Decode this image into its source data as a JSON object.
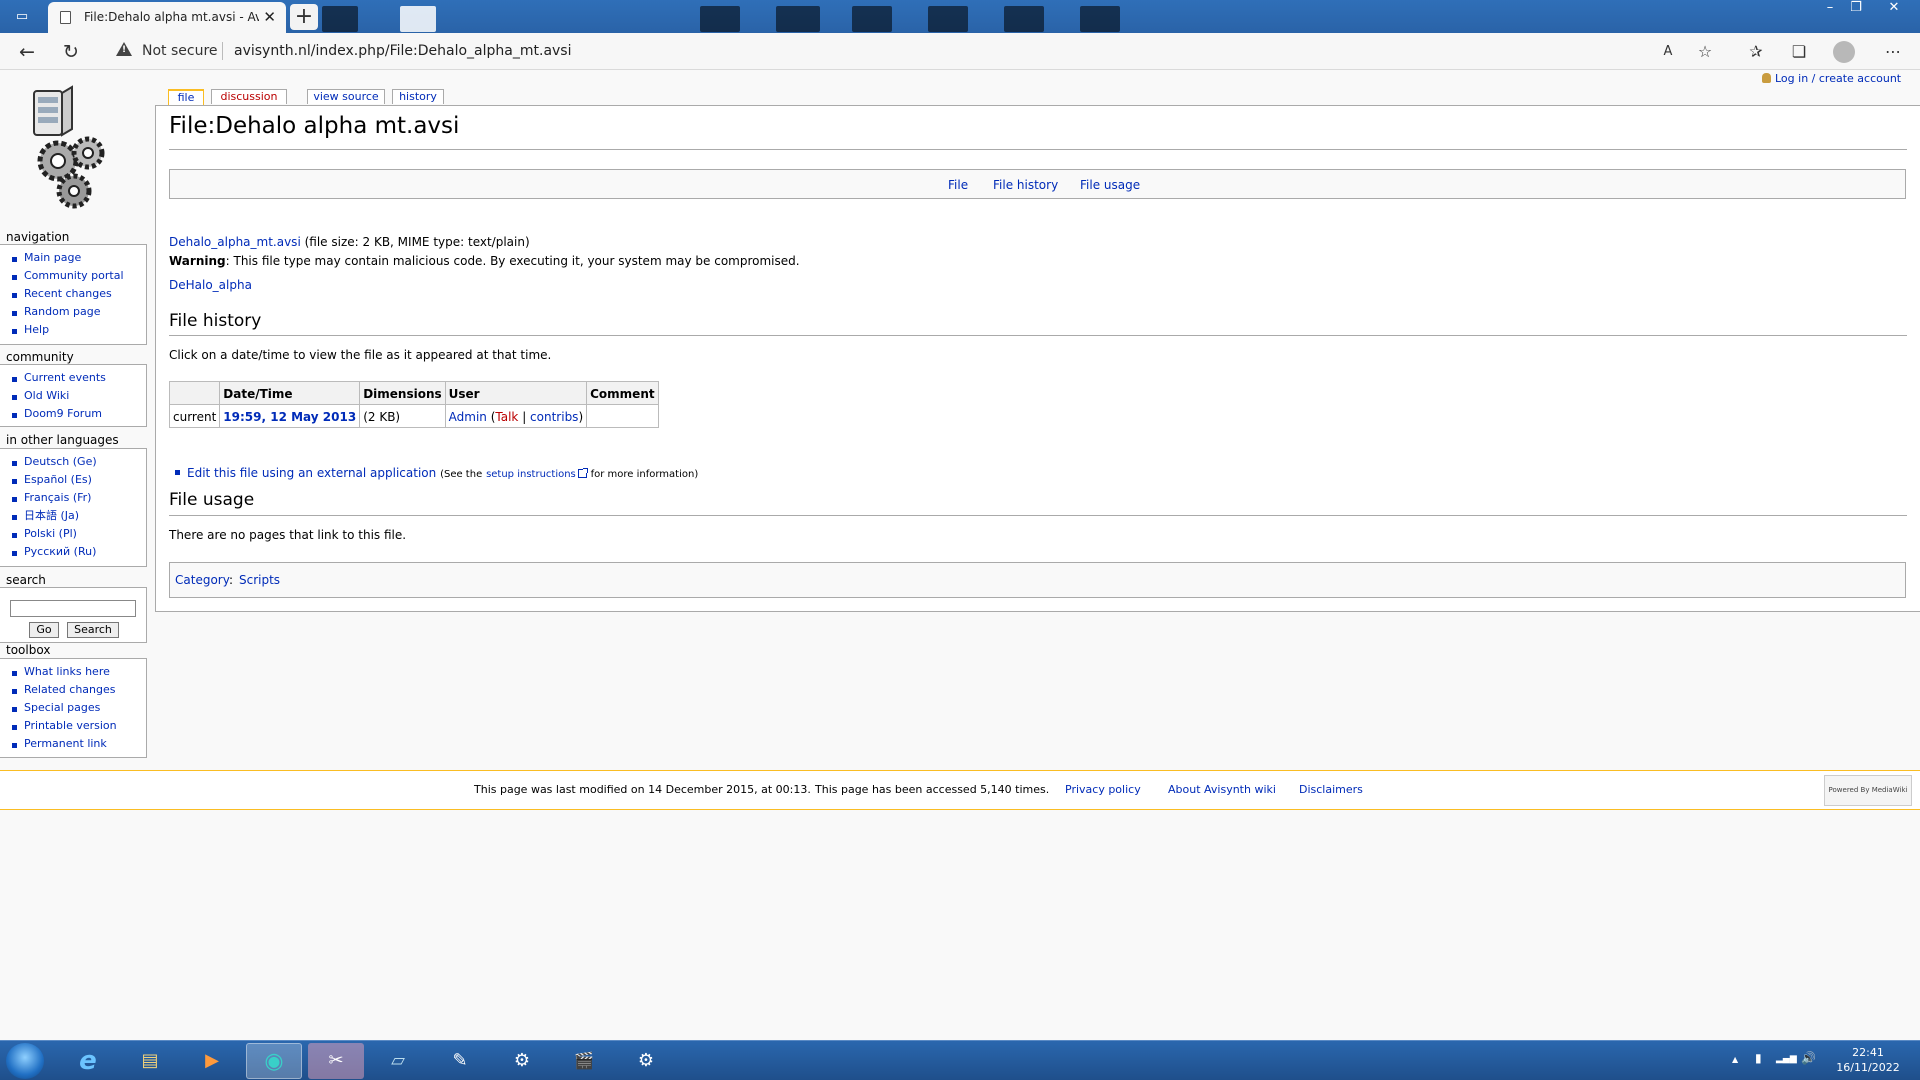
{
  "browser": {
    "tab_title": "File:Dehalo alpha mt.avsi - Avisynth",
    "tab_close": "✕",
    "new_tab": "+",
    "not_secure": "Not secure",
    "url": "avisynth.nl/index.php/File:Dehalo_alpha_mt.avsi",
    "icons": [
      "tab-actions-icon",
      "page-icon",
      "back-arrow-icon",
      "refresh-icon",
      "warning-icon",
      "read-aloud-icon",
      "add-favorite-icon",
      "favorites-icon",
      "collections-icon",
      "profile-icon",
      "more-icon"
    ],
    "window_controls": {
      "minimize": "–",
      "restore": "❐",
      "close": "✕"
    },
    "toolbar_glyphs": {
      "back": "←",
      "refresh": "↻",
      "read_aloud": "A",
      "add_favorite": "☆",
      "favorites": "✰",
      "collections": "❏",
      "more": "⋯"
    }
  },
  "personal": {
    "login": "Log in / create account"
  },
  "tabs": {
    "file": "file",
    "discussion": "discussion",
    "view_source": "view source",
    "history": "history"
  },
  "page": {
    "title": "File:Dehalo alpha mt.avsi",
    "filetoc": [
      "File",
      "File history",
      "File usage"
    ],
    "file_link": "Dehalo_alpha_mt.avsi",
    "file_info": "(file size: 2 KB, MIME type: text/plain)",
    "warning_label": "Warning",
    "warning_text": ": This file type may contain malicious code. By executing it, your system may be compromised.",
    "related_link": "DeHalo_alpha",
    "history_heading": "File history",
    "history_note": "Click on a date/time to view the file as it appeared at that time.",
    "history_table": {
      "headers": [
        "",
        "Date/Time",
        "Dimensions",
        "User",
        "Comment"
      ],
      "row": {
        "status": "current",
        "datetime": "19:59, 12 May 2013",
        "dimensions": "(2 KB)",
        "user": "Admin",
        "open_paren": " (",
        "talk": "Talk",
        "sep": " | ",
        "contribs": "contribs",
        "close_paren": ")",
        "comment": ""
      }
    },
    "edit_external": "Edit this file using an external application",
    "edit_note_pre": "(See the",
    "setup_link": "setup instructions",
    "edit_note_post": "for more information)",
    "usage_heading": "File usage",
    "usage_text": "There are no pages that link to this file.",
    "category_label": "Category",
    "category_colon": ":",
    "category": "Scripts"
  },
  "sidebar": {
    "navigation": {
      "heading": "navigation",
      "items": [
        "Main page",
        "Community portal",
        "Recent changes",
        "Random page",
        "Help"
      ]
    },
    "community": {
      "heading": "community",
      "items": [
        "Current events",
        "Old Wiki",
        "Doom9 Forum"
      ]
    },
    "languages": {
      "heading": "in other languages",
      "items": [
        "Deutsch (Ge)",
        "Español (Es)",
        "Français (Fr)",
        "日本語 (Ja)",
        "Polski (Pl)",
        "Русский (Ru)"
      ]
    },
    "search": {
      "heading": "search",
      "go": "Go",
      "search": "Search"
    },
    "toolbox": {
      "heading": "toolbox",
      "items": [
        "What links here",
        "Related changes",
        "Special pages",
        "Printable version",
        "Permanent link"
      ]
    }
  },
  "footer": {
    "last_modified": "This page was last modified on 14 December 2015, at 00:13.",
    "accessed": "This page has been accessed 5,140 times.",
    "privacy": "Privacy policy",
    "about": "About Avisynth wiki",
    "disclaimers": "Disclaimers",
    "powered": "Powered By MediaWiki"
  },
  "taskbar": {
    "apps": [
      "internet-explorer-icon",
      "file-explorer-icon",
      "media-player-icon",
      "edge-icon",
      "paint-tool-icon",
      "notepad-icon",
      "editor-icon",
      "settings-gear-icon",
      "clapperboard-icon",
      "system-gear-icon"
    ],
    "app_glyphs": [
      "e",
      "▤",
      "▶",
      "◉",
      "✂",
      "▱",
      "✎",
      "⚙",
      "🎬",
      "⚙"
    ],
    "tray_glyphs": {
      "show_hidden": "▲",
      "network_device": "▮",
      "signal": "▂▄▆",
      "volume": "🔊"
    },
    "time": "22:41",
    "date": "16/11/2022"
  },
  "colors": {
    "link": "#002bb8",
    "new_link": "#ba0000",
    "accent": "#fabd23",
    "taskbar": "#2a67ae"
  }
}
